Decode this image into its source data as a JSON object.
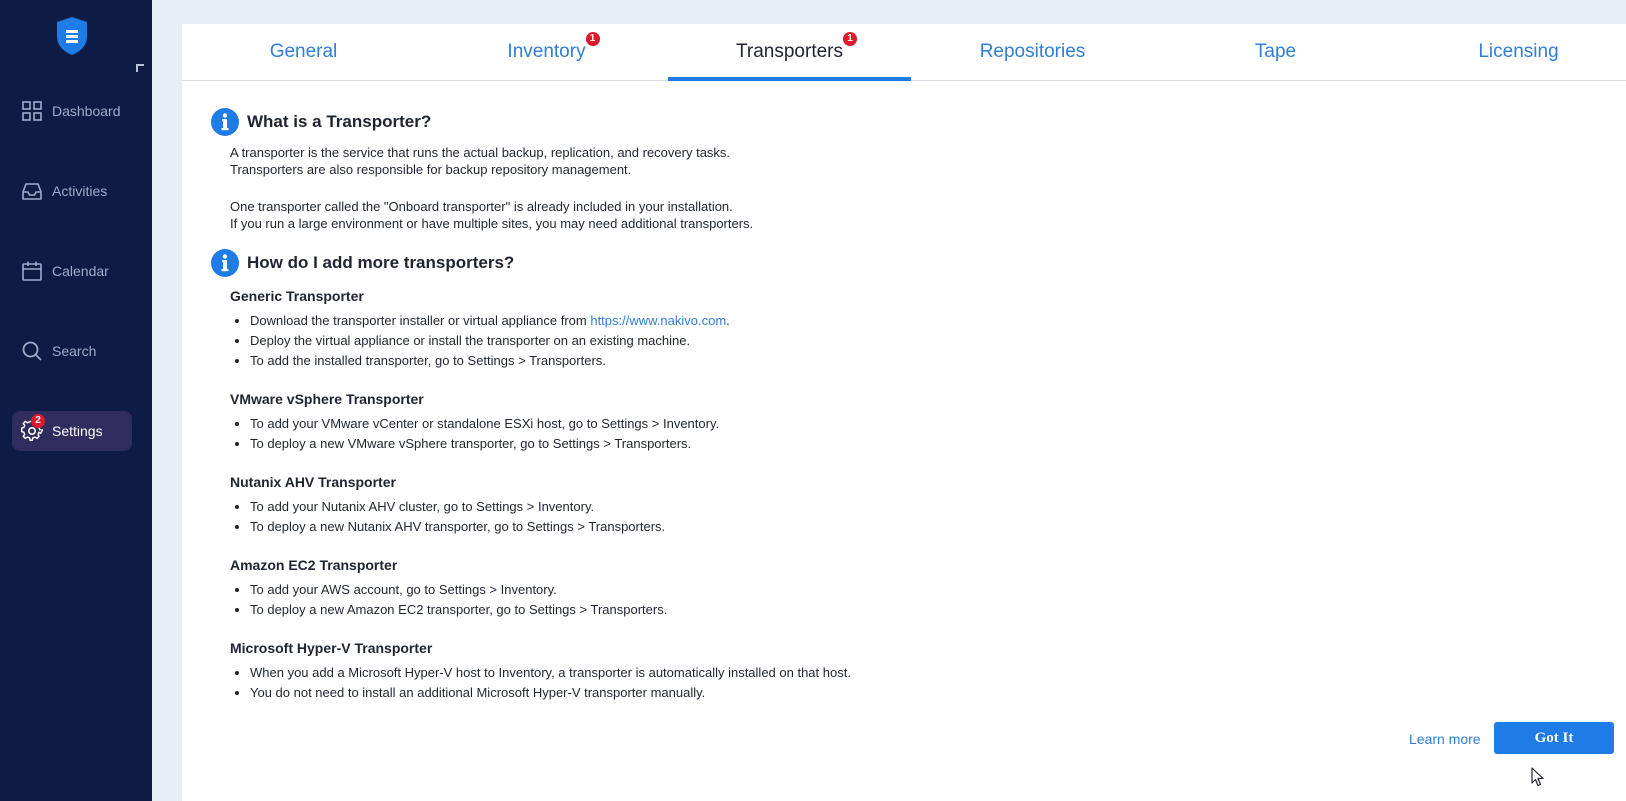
{
  "sidebar": {
    "items": [
      {
        "label": "Dashboard",
        "icon": "dashboard-icon"
      },
      {
        "label": "Activities",
        "icon": "inbox-icon"
      },
      {
        "label": "Calendar",
        "icon": "calendar-icon"
      },
      {
        "label": "Search",
        "icon": "search-icon"
      },
      {
        "label": "Settings",
        "icon": "gear-icon",
        "badge": "2",
        "active": true
      }
    ]
  },
  "tabs": [
    {
      "label": "General"
    },
    {
      "label": "Inventory",
      "badge": "1"
    },
    {
      "label": "Transporters",
      "badge": "1",
      "active": true
    },
    {
      "label": "Repositories"
    },
    {
      "label": "Tape"
    },
    {
      "label": "Licensing"
    }
  ],
  "content": {
    "what": {
      "title": "What is a Transporter?",
      "lines": [
        "A transporter is the service that runs the actual backup, replication, and recovery tasks.",
        "Transporters are also responsible for backup repository management.",
        "One transporter called the \"Onboard transporter\" is already included in your installation.",
        "If you run a large environment or have multiple sites, you may need additional transporters."
      ]
    },
    "how": {
      "title": "How do I add more transporters?",
      "generic": {
        "title": "Generic Transporter",
        "b1_prefix": "Download the transporter installer or virtual appliance from ",
        "b1_link": "https://www.nakivo.com",
        "b1_suffix": ".",
        "b2": "Deploy the virtual appliance or install the transporter on an existing machine.",
        "b3": "To add the installed transporter, go to Settings > Transporters."
      },
      "vmware": {
        "title": "VMware vSphere Transporter",
        "b1": "To add your VMware vCenter or standalone ESXi host, go to Settings > Inventory.",
        "b2": "To deploy a new VMware vSphere transporter, go to Settings > Transporters."
      },
      "nutanix": {
        "title": "Nutanix AHV Transporter",
        "b1": "To add your Nutanix AHV cluster, go to Settings > Inventory.",
        "b2": "To deploy a new Nutanix AHV transporter, go to Settings > Transporters."
      },
      "ec2": {
        "title": "Amazon EC2 Transporter",
        "b1": "To add your AWS account, go to Settings > Inventory.",
        "b2": "To deploy a new Amazon EC2 transporter, go to Settings > Transporters."
      },
      "hyperv": {
        "title": "Microsoft Hyper-V Transporter",
        "b1": "When you add a Microsoft Hyper-V host to Inventory, a transporter is automatically installed on that host.",
        "b2": "You do not need to install an additional Microsoft Hyper-V transporter manually."
      }
    }
  },
  "footer": {
    "learn_more": "Learn more",
    "got_it": "Got It"
  },
  "colors": {
    "sidebar_bg": "#0d1b45",
    "accent": "#1f7be6",
    "link": "#2d7fd7",
    "badge": "#e0192c"
  }
}
